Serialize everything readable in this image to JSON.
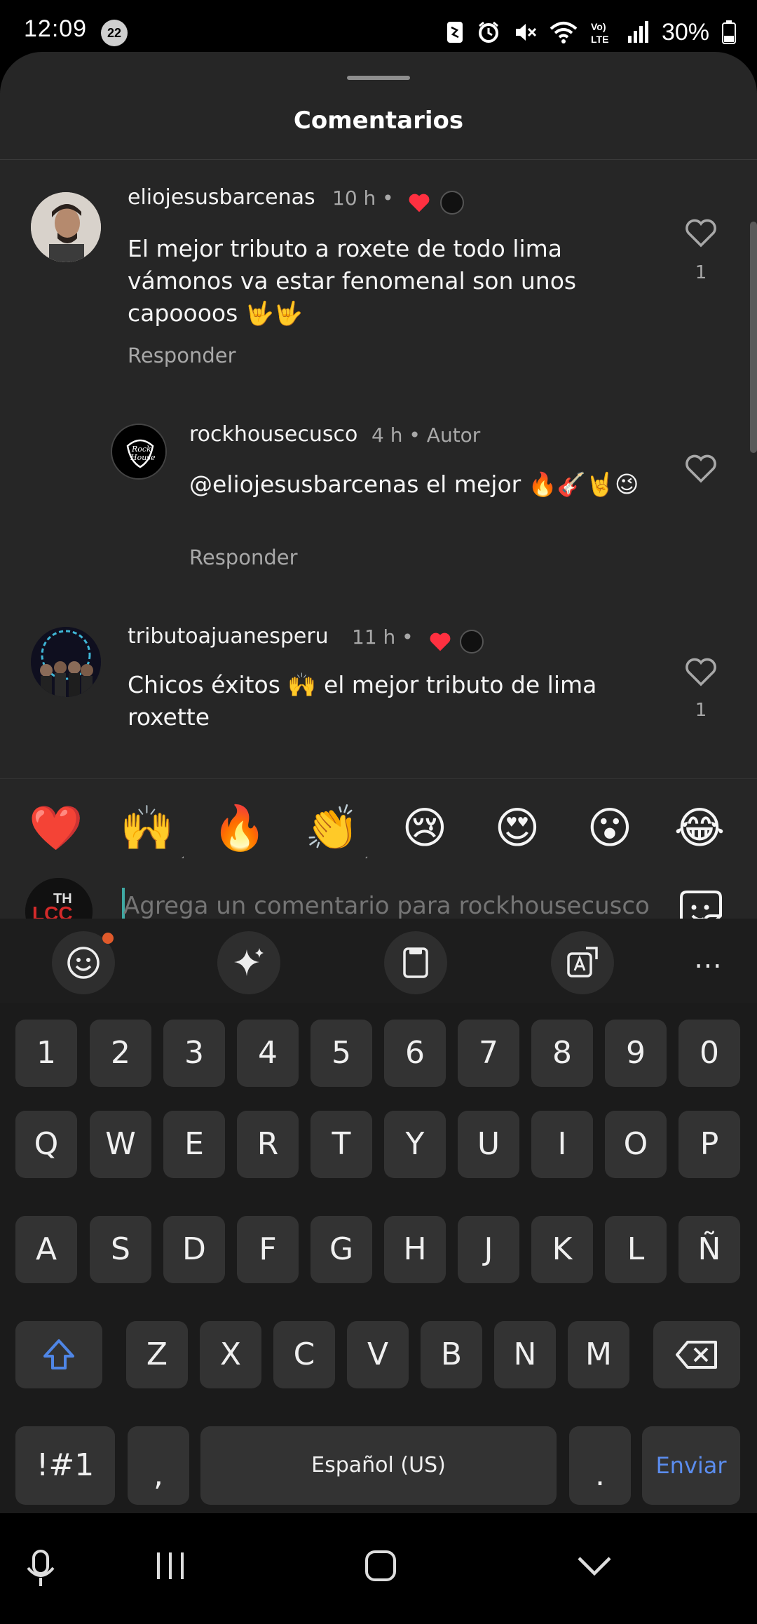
{
  "status_bar": {
    "time": "12:09",
    "notification_count": "22",
    "battery": "30%",
    "icons": [
      "nfc-icon",
      "alarm-icon",
      "mute-icon",
      "wifi-icon",
      "volte-icon",
      "signal-icon",
      "battery-icon"
    ]
  },
  "sheet": {
    "title": "Comentarios"
  },
  "comments": [
    {
      "username": "eliojesusbarcenas",
      "time": "10 h",
      "text": "El mejor tributo a roxete de todo lima vámonos va estar  fenomenal son unos capoooos 🤟🤟",
      "reply_label": "Responder",
      "like_count": "1",
      "liked_by_author": true
    },
    {
      "username": "rockhousecusco",
      "time": "4 h",
      "author_label": "Autor",
      "text": "@eliojesusbarcenas el mejor 🔥🎸🤘😉",
      "reply_label": "Responder",
      "like_count": ""
    },
    {
      "username": "tributoajuanesperu",
      "time": "11 h",
      "text": "Chicos éxitos 🙌  el mejor tributo  de lima roxette",
      "like_count": "1",
      "liked_by_author": true
    }
  ],
  "emoji_bar": [
    "❤️",
    "🙌",
    "🔥",
    "👏",
    "😢",
    "😍",
    "😮",
    "😂"
  ],
  "composer": {
    "placeholder": "Agrega un comentario para rockhousecusco..."
  },
  "keyboard": {
    "row_numbers": [
      "1",
      "2",
      "3",
      "4",
      "5",
      "6",
      "7",
      "8",
      "9",
      "0"
    ],
    "row_1": [
      "Q",
      "W",
      "E",
      "R",
      "T",
      "Y",
      "U",
      "I",
      "O",
      "P"
    ],
    "row_2": [
      "A",
      "S",
      "D",
      "F",
      "G",
      "H",
      "J",
      "K",
      "L",
      "Ñ"
    ],
    "row_3": [
      "Z",
      "X",
      "C",
      "V",
      "B",
      "N",
      "M"
    ],
    "symbols_label": "!#1",
    "comma_label": ",",
    "space_label": "Español (US)",
    "period_label": ".",
    "send_label": "Enviar"
  },
  "colors": {
    "sheet_bg": "#262626",
    "key_bg": "#333333",
    "like_red": "#ff3040",
    "send_blue": "#5b8def"
  }
}
